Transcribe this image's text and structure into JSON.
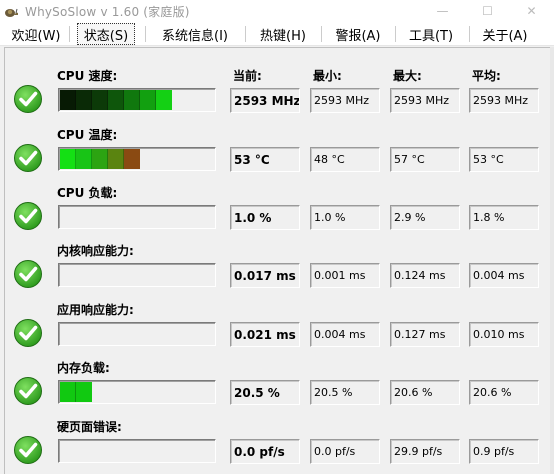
{
  "window": {
    "title": "WhySoSlow v 1.60  (家庭版)",
    "minimize": "—",
    "maximize": "☐",
    "close": "✕"
  },
  "menu": [
    {
      "label": "欢迎(W)",
      "active": false
    },
    {
      "label": "状态(S)",
      "active": true
    },
    {
      "label": "系统信息(I)",
      "active": false
    },
    {
      "label": "热键(H)",
      "active": false
    },
    {
      "label": "警报(A)",
      "active": false
    },
    {
      "label": "工具(T)",
      "active": false
    },
    {
      "label": "关于(A)",
      "active": false
    }
  ],
  "headers": {
    "current": "当前:",
    "min": "最小:",
    "max": "最大:",
    "avg": "平均:"
  },
  "colors": {
    "check_green": "#2e9b1e",
    "bar_dark": "#0b2a06",
    "bar_green": "#11c911",
    "bar_brown": "#8a3a10"
  },
  "rows": [
    {
      "label": "CPU 速度:",
      "current": "2593 MHz",
      "min": "2593 MHz",
      "max": "2593 MHz",
      "avg": "2593 MHz",
      "segments": 7,
      "scheme": "speed"
    },
    {
      "label": "CPU 温度:",
      "current": "53 °C",
      "min": "48 °C",
      "max": "57 °C",
      "avg": "53 °C",
      "segments": 5,
      "scheme": "temp"
    },
    {
      "label": "CPU 负载:",
      "current": "1.0 %",
      "min": "1.0 %",
      "max": "2.9 %",
      "avg": "1.8 %",
      "segments": 0,
      "scheme": "load"
    },
    {
      "label": "内核响应能力:",
      "current": "0.017 ms",
      "min": "0.001 ms",
      "max": "0.124 ms",
      "avg": "0.004 ms",
      "segments": 0,
      "scheme": "load"
    },
    {
      "label": "应用响应能力:",
      "current": "0.021 ms",
      "min": "0.004 ms",
      "max": "0.127 ms",
      "avg": "0.010 ms",
      "segments": 0,
      "scheme": "load"
    },
    {
      "label": "内存负载:",
      "current": "20.5 %",
      "min": "20.5 %",
      "max": "20.6 %",
      "avg": "20.6 %",
      "segments": 2,
      "scheme": "mem"
    },
    {
      "label": "硬页面错误:",
      "current": "0.0 pf/s",
      "min": "0.0 pf/s",
      "max": "29.9 pf/s",
      "avg": "0.9 pf/s",
      "segments": 0,
      "scheme": "load"
    }
  ]
}
